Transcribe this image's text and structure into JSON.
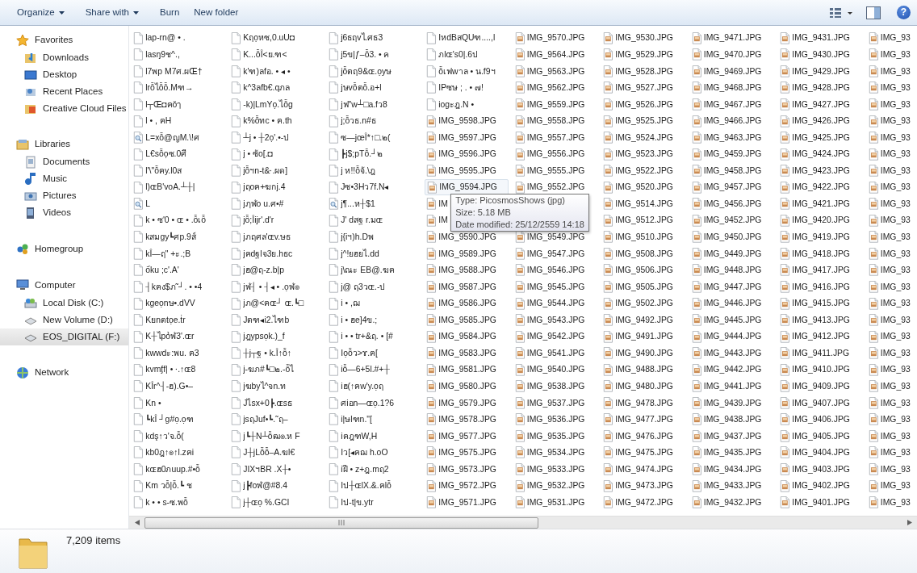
{
  "toolbar": {
    "buttons": [
      {
        "label": "Organize",
        "dropdown": true
      },
      {
        "label": "Share with",
        "dropdown": true
      },
      {
        "label": "Burn",
        "dropdown": false
      },
      {
        "label": "New folder",
        "dropdown": false
      }
    ],
    "help_glyph": "?"
  },
  "sidebar": {
    "groups": [
      {
        "label": "Favorites",
        "selected": false,
        "children": [
          {
            "label": "Downloads",
            "selected": false
          },
          {
            "label": "Desktop",
            "selected": false
          },
          {
            "label": "Recent Places",
            "selected": false
          },
          {
            "label": "Creative Cloud Files",
            "selected": false
          }
        ]
      },
      {
        "label": "Libraries",
        "selected": false,
        "children": [
          {
            "label": "Documents",
            "selected": false
          },
          {
            "label": "Music",
            "selected": false
          },
          {
            "label": "Pictures",
            "selected": false
          },
          {
            "label": "Videos",
            "selected": false
          }
        ]
      },
      {
        "label": "Homegroup",
        "selected": false
      },
      {
        "label": "Computer",
        "selected": false,
        "children": [
          {
            "label": "Local Disk (C:)",
            "selected": false
          },
          {
            "label": "New Volume (D:)",
            "selected": false
          },
          {
            "label": "EOS_DIGITAL (F:)",
            "selected": true
          }
        ]
      },
      {
        "label": "Network",
        "selected": false
      }
    ]
  },
  "files": {
    "columns": [
      [
        {
          "name": "lap-rn@ • .",
          "kind": "doc"
        },
        {
          "name": "lasŋ9ช^.,",
          "kind": "doc"
        },
        {
          "name": "l7พp M7ศ.ผŒ†",
          "kind": "doc"
        },
        {
          "name": "lrỗไỗỗ.Mฑ→",
          "kind": "doc"
        },
        {
          "name": "l┬Œ◘ฅǒๅ",
          "kind": "doc"
        },
        {
          "name": "l • , ฅH",
          "kind": "doc"
        },
        {
          "name": "L=xỗ@ญM.\\!ศ",
          "kind": "search"
        },
        {
          "name": "L€sỗọซ.0ศี",
          "kind": "doc"
        },
        {
          "name": "l'\\\"ỗฅy.l0ส",
          "kind": "doc"
        },
        {
          "name": "l)ɶB'voA.┴┼|",
          "kind": "doc"
        },
        {
          "name": "L",
          "kind": "search"
        },
        {
          "name": "k • ซ'0 • ɶ • .ỗเỗ",
          "kind": "doc"
        },
        {
          "name": "kสมgy┗ศp.9ส์",
          "kind": "doc"
        },
        {
          "name": "kÎ—ฤ\" +ะ.;B",
          "kind": "doc"
        },
        {
          "name": "ốku ;c'.A'",
          "kind": "doc"
        },
        {
          "name": "┤kฅง$ภ˜┘. • •4",
          "kind": "doc"
        },
        {
          "name": "kgeọnษ•.dVV",
          "kind": "doc"
        },
        {
          "name": "Kยnตtọe.ṫr",
          "kind": "doc"
        },
        {
          "name": "K┼ไpỏฬ3'.ɶr",
          "kind": "doc"
        },
        {
          "name": "kwwdะ:พu. ฅ3",
          "kind": "doc"
        },
        {
          "name": "kvmᶂf| • ⸱.↑ɶ8",
          "kind": "doc"
        },
        {
          "name": "KÎr^┤-ฮ).G•–",
          "kind": "doc"
        },
        {
          "name": "Kn •",
          "kind": "doc"
        },
        {
          "name": "┗kÎ ┘g#ọ.ọฑ",
          "kind": "doc"
        },
        {
          "name": "kdş↑ว'จ.ỗ(",
          "kind": "doc"
        },
        {
          "name": "kb0ฎ↑๏↑l.zฅi",
          "kind": "doc"
        },
        {
          "name": "kɶฮ0ภuup.#•ỗ",
          "kind": "doc"
        },
        {
          "name": "Km วỗ|ỗ.┗ ช",
          "kind": "doc"
        },
        {
          "name": "k • • s-ซ.พỗ",
          "kind": "doc"
        }
      ],
      [
        {
          "name": "Kฤọหซ,0.uU◘",
          "kind": "doc"
        },
        {
          "name": "K...ỗÎ<ย.ฑ<",
          "kind": "doc"
        },
        {
          "name": "k'ฑ)ลfอ. • ◂ •",
          "kind": "doc"
        },
        {
          "name": "k^3ลfb€.qภล",
          "kind": "doc"
        },
        {
          "name": "-k)|LmYọ.ไỗg",
          "kind": "doc"
        },
        {
          "name": "k%ỗทc • ฅ.th",
          "kind": "doc"
        },
        {
          "name": "┴j • ┼2ọ'.•-ป",
          "kind": "doc"
        },
        {
          "name": "j • ซ้o[.◘",
          "kind": "doc"
        },
        {
          "name": "jỗฯn-t&⸱.ผด]",
          "kind": "doc"
        },
        {
          "name": "jฤoฅ+ฆกj.4",
          "kind": "doc"
        },
        {
          "name": "jฦฬo u.ศ•#",
          "kind": "doc"
        },
        {
          "name": "jỗ;Îijr'.d'r",
          "kind": "doc"
        },
        {
          "name": "jภฤศล'ɶv.ษธ",
          "kind": "doc"
        },
        {
          "name": "jฅdฐlจ3ย.hธc",
          "kind": "doc"
        },
        {
          "name": "jฮ@ฤ-z.b|p",
          "kind": "doc"
        },
        {
          "name": "jฬ┤ • ┤◂ • .ọฬ๏",
          "kind": "doc"
        },
        {
          "name": "jภ@<ฅɶ┘ ɶ.┗□",
          "kind": "doc"
        },
        {
          "name": "Jตฑ◂i2.ไฑb",
          "kind": "doc"
        },
        {
          "name": "jฎypsọk.)_f",
          "kind": "doc"
        },
        {
          "name": "┼j┬ฐ • k.Î↑ỗ↑",
          "kind": "doc"
        },
        {
          "name": "j-ฆภ#┗□๒.-ỗไ",
          "kind": "doc"
        },
        {
          "name": "jฆbyไ^จn.ท",
          "kind": "doc"
        },
        {
          "name": "Jไsx+0┣.ɶsธ",
          "kind": "doc"
        },
        {
          "name": "jsฤJuf•┗.˜ฤ–",
          "kind": "doc"
        },
        {
          "name": "j┗┼N┴ỗฒ๏.ห F",
          "kind": "doc"
        },
        {
          "name": "J┼jLỗỗ–A.ฆl€",
          "kind": "doc"
        },
        {
          "name": "JIXฯBR .X┼•",
          "kind": "doc"
        },
        {
          "name": "j┣foฬ@#8.4",
          "kind": "doc"
        },
        {
          "name": "j┼ɶọ %.GCI",
          "kind": "doc"
        }
      ],
      [
        {
          "name": "j6ธฤvไ.ศธ3",
          "kind": "doc"
        },
        {
          "name": "j5ข|ƒ–ỗ3. • ค",
          "kind": "doc"
        },
        {
          "name": "jỗตฤ9&ɶ.ọyษ",
          "kind": "doc"
        },
        {
          "name": "jษvỗตỗ.อ+l",
          "kind": "doc"
        },
        {
          "name": "jฟ\"w┴□a.fว8",
          "kind": "doc"
        },
        {
          "name": "j;ỗวธ.n#ธ",
          "kind": "doc"
        },
        {
          "name": "ซ—jœÎ*↑□.๒(",
          "kind": "doc"
        },
        {
          "name": "┣j$;pTỗ.┘๒",
          "kind": "doc"
        },
        {
          "name": "j ห!!ỗจ้.\\ฎ",
          "kind": "doc"
        },
        {
          "name": "Jซ•3Hว7f.N◂",
          "kind": "doc"
        },
        {
          "name": "j¶...ห┼$1",
          "kind": "search"
        },
        {
          "name": "J' dสฐ r.มɶ",
          "kind": "doc"
        },
        {
          "name": "j{iฯ)h.Dพ",
          "kind": "doc"
        },
        {
          "name": "j^!ยฮยไ.dd",
          "kind": "doc"
        },
        {
          "name": "j\\ณะ EB@.ฆฅ",
          "kind": "doc"
        },
        {
          "name": "j@ ฤ3วɶ.-ป",
          "kind": "doc"
        },
        {
          "name": "i • ,ฌ",
          "kind": "doc"
        },
        {
          "name": "i • ฮe]4ข.;",
          "kind": "doc"
        },
        {
          "name": "i • • tr+&ฤ. • [#",
          "kind": "doc"
        },
        {
          "name": "Iọỗว>ɤ.ฅ[",
          "kind": "doc"
        },
        {
          "name": "iỗ—6+5l.#+┼",
          "kind": "doc"
        },
        {
          "name": "iฮ(↑ฅw'y.ọฤ",
          "kind": "doc"
        },
        {
          "name": "ศiอn—ɶọ.1?6",
          "kind": "doc"
        },
        {
          "name": "i|ษlฑn.\"[",
          "kind": "doc"
        },
        {
          "name": "iฅฎฑW,H",
          "kind": "doc"
        },
        {
          "name": "Iว[◂ฅฌ h.oO",
          "kind": "doc"
        },
        {
          "name": "iฝี • z+ฎ.mฤ2",
          "kind": "doc"
        },
        {
          "name": "Iป┼ɶlX.&.ฅlỗ",
          "kind": "doc"
        },
        {
          "name": "Iป-t|ข.ytr",
          "kind": "doc"
        }
      ],
      [
        {
          "name": "IหdBสQUฑ....,l",
          "kind": "doc"
        },
        {
          "name": "ภlɶ's0|.6ป",
          "kind": "doc"
        },
        {
          "name": "ỗเฟwาล • น.f9ฯ",
          "kind": "doc"
        },
        {
          "name": "IPซษ ; . • ๗!",
          "kind": "doc"
        },
        {
          "name": "iogะฎ.N •",
          "kind": "doc"
        },
        {
          "name": "IMG_9598.JPG",
          "kind": "image"
        },
        {
          "name": "IMG_9597.JPG",
          "kind": "image"
        },
        {
          "name": "IMG_9596.JPG",
          "kind": "image"
        },
        {
          "name": "IMG_9595.JPG",
          "kind": "image"
        },
        {
          "name": "IMG_9594.JPG",
          "kind": "image",
          "hovered": true
        },
        {
          "name": "IM",
          "kind": "image"
        },
        {
          "name": "IM",
          "kind": "image"
        },
        {
          "name": "IMG_9590.JPG",
          "kind": "image"
        },
        {
          "name": "IMG_9589.JPG",
          "kind": "image"
        },
        {
          "name": "IMG_9588.JPG",
          "kind": "image"
        },
        {
          "name": "IMG_9587.JPG",
          "kind": "image"
        },
        {
          "name": "IMG_9586.JPG",
          "kind": "image"
        },
        {
          "name": "IMG_9585.JPG",
          "kind": "image"
        },
        {
          "name": "IMG_9584.JPG",
          "kind": "image"
        },
        {
          "name": "IMG_9583.JPG",
          "kind": "image"
        },
        {
          "name": "IMG_9581.JPG",
          "kind": "image"
        },
        {
          "name": "IMG_9580.JPG",
          "kind": "image"
        },
        {
          "name": "IMG_9579.JPG",
          "kind": "image"
        },
        {
          "name": "IMG_9578.JPG",
          "kind": "image"
        },
        {
          "name": "IMG_9577.JPG",
          "kind": "image"
        },
        {
          "name": "IMG_9575.JPG",
          "kind": "image"
        },
        {
          "name": "IMG_9573.JPG",
          "kind": "image"
        },
        {
          "name": "IMG_9572.JPG",
          "kind": "image"
        },
        {
          "name": "IMG_9571.JPG",
          "kind": "image"
        }
      ],
      [
        {
          "name": "IMG_9570.JPG",
          "kind": "image"
        },
        {
          "name": "IMG_9564.JPG",
          "kind": "image"
        },
        {
          "name": "IMG_9563.JPG",
          "kind": "image"
        },
        {
          "name": "IMG_9562.JPG",
          "kind": "image"
        },
        {
          "name": "IMG_9559.JPG",
          "kind": "image"
        },
        {
          "name": "IMG_9558.JPG",
          "kind": "image"
        },
        {
          "name": "IMG_9557.JPG",
          "kind": "image"
        },
        {
          "name": "IMG_9556.JPG",
          "kind": "image"
        },
        {
          "name": "IMG_9555.JPG",
          "kind": "image"
        },
        {
          "name": "IMG_9552.JPG",
          "kind": "image"
        },
        {
          "kind": "covered"
        },
        {
          "kind": "covered"
        },
        {
          "name": "IMG_9549.JPG",
          "kind": "image"
        },
        {
          "name": "IMG_9547.JPG",
          "kind": "image"
        },
        {
          "name": "IMG_9546.JPG",
          "kind": "image"
        },
        {
          "name": "IMG_9545.JPG",
          "kind": "image"
        },
        {
          "name": "IMG_9544.JPG",
          "kind": "image"
        },
        {
          "name": "IMG_9543.JPG",
          "kind": "image"
        },
        {
          "name": "IMG_9542.JPG",
          "kind": "image"
        },
        {
          "name": "IMG_9541.JPG",
          "kind": "image"
        },
        {
          "name": "IMG_9540.JPG",
          "kind": "image"
        },
        {
          "name": "IMG_9538.JPG",
          "kind": "image"
        },
        {
          "name": "IMG_9537.JPG",
          "kind": "image"
        },
        {
          "name": "IMG_9536.JPG",
          "kind": "image"
        },
        {
          "name": "IMG_9535.JPG",
          "kind": "image"
        },
        {
          "name": "IMG_9534.JPG",
          "kind": "image"
        },
        {
          "name": "IMG_9533.JPG",
          "kind": "image"
        },
        {
          "name": "IMG_9532.JPG",
          "kind": "image"
        },
        {
          "name": "IMG_9531.JPG",
          "kind": "image"
        }
      ],
      [
        {
          "name": "IMG_9530.JPG",
          "kind": "image"
        },
        {
          "name": "IMG_9529.JPG",
          "kind": "image"
        },
        {
          "name": "IMG_9528.JPG",
          "kind": "image"
        },
        {
          "name": "IMG_9527.JPG",
          "kind": "image"
        },
        {
          "name": "IMG_9526.JPG",
          "kind": "image"
        },
        {
          "name": "IMG_9525.JPG",
          "kind": "image"
        },
        {
          "name": "IMG_9524.JPG",
          "kind": "image"
        },
        {
          "name": "IMG_9523.JPG",
          "kind": "image"
        },
        {
          "name": "IMG_9522.JPG",
          "kind": "image"
        },
        {
          "name": "IMG_9520.JPG",
          "kind": "image"
        },
        {
          "name": "IMG_9514.JPG",
          "kind": "image"
        },
        {
          "name": "IMG_9512.JPG",
          "kind": "image"
        },
        {
          "name": "IMG_9510.JPG",
          "kind": "image"
        },
        {
          "name": "IMG_9508.JPG",
          "kind": "image"
        },
        {
          "name": "IMG_9506.JPG",
          "kind": "image"
        },
        {
          "name": "IMG_9505.JPG",
          "kind": "image"
        },
        {
          "name": "IMG_9502.JPG",
          "kind": "image"
        },
        {
          "name": "IMG_9492.JPG",
          "kind": "image"
        },
        {
          "name": "IMG_9491.JPG",
          "kind": "image"
        },
        {
          "name": "IMG_9490.JPG",
          "kind": "image"
        },
        {
          "name": "IMG_9488.JPG",
          "kind": "image"
        },
        {
          "name": "IMG_9480.JPG",
          "kind": "image"
        },
        {
          "name": "IMG_9478.JPG",
          "kind": "image"
        },
        {
          "name": "IMG_9477.JPG",
          "kind": "image"
        },
        {
          "name": "IMG_9476.JPG",
          "kind": "image"
        },
        {
          "name": "IMG_9475.JPG",
          "kind": "image"
        },
        {
          "name": "IMG_9474.JPG",
          "kind": "image"
        },
        {
          "name": "IMG_9473.JPG",
          "kind": "image"
        },
        {
          "name": "IMG_9472.JPG",
          "kind": "image"
        }
      ],
      [
        {
          "name": "IMG_9471.JPG",
          "kind": "image"
        },
        {
          "name": "IMG_9470.JPG",
          "kind": "image"
        },
        {
          "name": "IMG_9469.JPG",
          "kind": "image"
        },
        {
          "name": "IMG_9468.JPG",
          "kind": "image"
        },
        {
          "name": "IMG_9467.JPG",
          "kind": "image"
        },
        {
          "name": "IMG_9466.JPG",
          "kind": "image"
        },
        {
          "name": "IMG_9463.JPG",
          "kind": "image"
        },
        {
          "name": "IMG_9459.JPG",
          "kind": "image"
        },
        {
          "name": "IMG_9458.JPG",
          "kind": "image"
        },
        {
          "name": "IMG_9457.JPG",
          "kind": "image"
        },
        {
          "name": "IMG_9456.JPG",
          "kind": "image"
        },
        {
          "name": "IMG_9452.JPG",
          "kind": "image"
        },
        {
          "name": "IMG_9450.JPG",
          "kind": "image"
        },
        {
          "name": "IMG_9449.JPG",
          "kind": "image"
        },
        {
          "name": "IMG_9448.JPG",
          "kind": "image"
        },
        {
          "name": "IMG_9447.JPG",
          "kind": "image"
        },
        {
          "name": "IMG_9446.JPG",
          "kind": "image"
        },
        {
          "name": "IMG_9445.JPG",
          "kind": "image"
        },
        {
          "name": "IMG_9444.JPG",
          "kind": "image"
        },
        {
          "name": "IMG_9443.JPG",
          "kind": "image"
        },
        {
          "name": "IMG_9442.JPG",
          "kind": "image"
        },
        {
          "name": "IMG_9441.JPG",
          "kind": "image"
        },
        {
          "name": "IMG_9439.JPG",
          "kind": "image"
        },
        {
          "name": "IMG_9438.JPG",
          "kind": "image"
        },
        {
          "name": "IMG_9437.JPG",
          "kind": "image"
        },
        {
          "name": "IMG_9435.JPG",
          "kind": "image"
        },
        {
          "name": "IMG_9434.JPG",
          "kind": "image"
        },
        {
          "name": "IMG_9433.JPG",
          "kind": "image"
        },
        {
          "name": "IMG_9432.JPG",
          "kind": "image"
        }
      ],
      [
        {
          "name": "IMG_9431.JPG",
          "kind": "image"
        },
        {
          "name": "IMG_9430.JPG",
          "kind": "image"
        },
        {
          "name": "IMG_9429.JPG",
          "kind": "image"
        },
        {
          "name": "IMG_9428.JPG",
          "kind": "image"
        },
        {
          "name": "IMG_9427.JPG",
          "kind": "image"
        },
        {
          "name": "IMG_9426.JPG",
          "kind": "image"
        },
        {
          "name": "IMG_9425.JPG",
          "kind": "image"
        },
        {
          "name": "IMG_9424.JPG",
          "kind": "image"
        },
        {
          "name": "IMG_9423.JPG",
          "kind": "image"
        },
        {
          "name": "IMG_9422.JPG",
          "kind": "image"
        },
        {
          "name": "IMG_9421.JPG",
          "kind": "image"
        },
        {
          "name": "IMG_9420.JPG",
          "kind": "image"
        },
        {
          "name": "IMG_9419.JPG",
          "kind": "image"
        },
        {
          "name": "IMG_9418.JPG",
          "kind": "image"
        },
        {
          "name": "IMG_9417.JPG",
          "kind": "image"
        },
        {
          "name": "IMG_9416.JPG",
          "kind": "image"
        },
        {
          "name": "IMG_9415.JPG",
          "kind": "image"
        },
        {
          "name": "IMG_9413.JPG",
          "kind": "image"
        },
        {
          "name": "IMG_9412.JPG",
          "kind": "image"
        },
        {
          "name": "IMG_9411.JPG",
          "kind": "image"
        },
        {
          "name": "IMG_9410.JPG",
          "kind": "image"
        },
        {
          "name": "IMG_9409.JPG",
          "kind": "image"
        },
        {
          "name": "IMG_9407.JPG",
          "kind": "image"
        },
        {
          "name": "IMG_9406.JPG",
          "kind": "image"
        },
        {
          "name": "IMG_9405.JPG",
          "kind": "image"
        },
        {
          "name": "IMG_9404.JPG",
          "kind": "image"
        },
        {
          "name": "IMG_9403.JPG",
          "kind": "image"
        },
        {
          "name": "IMG_9402.JPG",
          "kind": "image"
        },
        {
          "name": "IMG_9401.JPG",
          "kind": "image"
        }
      ],
      [
        {
          "name": "IMG_93",
          "kind": "image"
        },
        {
          "name": "IMG_93",
          "kind": "image"
        },
        {
          "name": "IMG_93",
          "kind": "image"
        },
        {
          "name": "IMG_93",
          "kind": "image"
        },
        {
          "name": "IMG_93",
          "kind": "image"
        },
        {
          "name": "IMG_93",
          "kind": "image"
        },
        {
          "name": "IMG_93",
          "kind": "image"
        },
        {
          "name": "IMG_93",
          "kind": "image"
        },
        {
          "name": "IMG_93",
          "kind": "image"
        },
        {
          "name": "IMG_93",
          "kind": "image"
        },
        {
          "name": "IMG_93",
          "kind": "image"
        },
        {
          "name": "IMG_93",
          "kind": "image"
        },
        {
          "name": "IMG_93",
          "kind": "image"
        },
        {
          "name": "IMG_93",
          "kind": "image"
        },
        {
          "name": "IMG_93",
          "kind": "image"
        },
        {
          "name": "IMG_93",
          "kind": "image"
        },
        {
          "name": "IMG_93",
          "kind": "image"
        },
        {
          "name": "IMG_93",
          "kind": "image"
        },
        {
          "name": "IMG_93",
          "kind": "image"
        },
        {
          "name": "IMG_93",
          "kind": "image"
        },
        {
          "name": "IMG_93",
          "kind": "image"
        },
        {
          "name": "IMG_93",
          "kind": "image"
        },
        {
          "name": "IMG_93",
          "kind": "image"
        },
        {
          "name": "IMG_93",
          "kind": "image"
        },
        {
          "name": "IMG_93",
          "kind": "image"
        },
        {
          "name": "IMG_93",
          "kind": "image"
        },
        {
          "name": "IMG_93",
          "kind": "image"
        },
        {
          "name": "IMG_93",
          "kind": "image"
        },
        {
          "name": "IMG_93",
          "kind": "image"
        }
      ]
    ]
  },
  "tooltip": {
    "lines": [
      "Type: PicosmosShows (jpg)",
      "Size: 5.18 MB",
      "Date modified: 25/12/2559 14:18"
    ]
  },
  "status_bar": {
    "count": "7,209 items"
  }
}
